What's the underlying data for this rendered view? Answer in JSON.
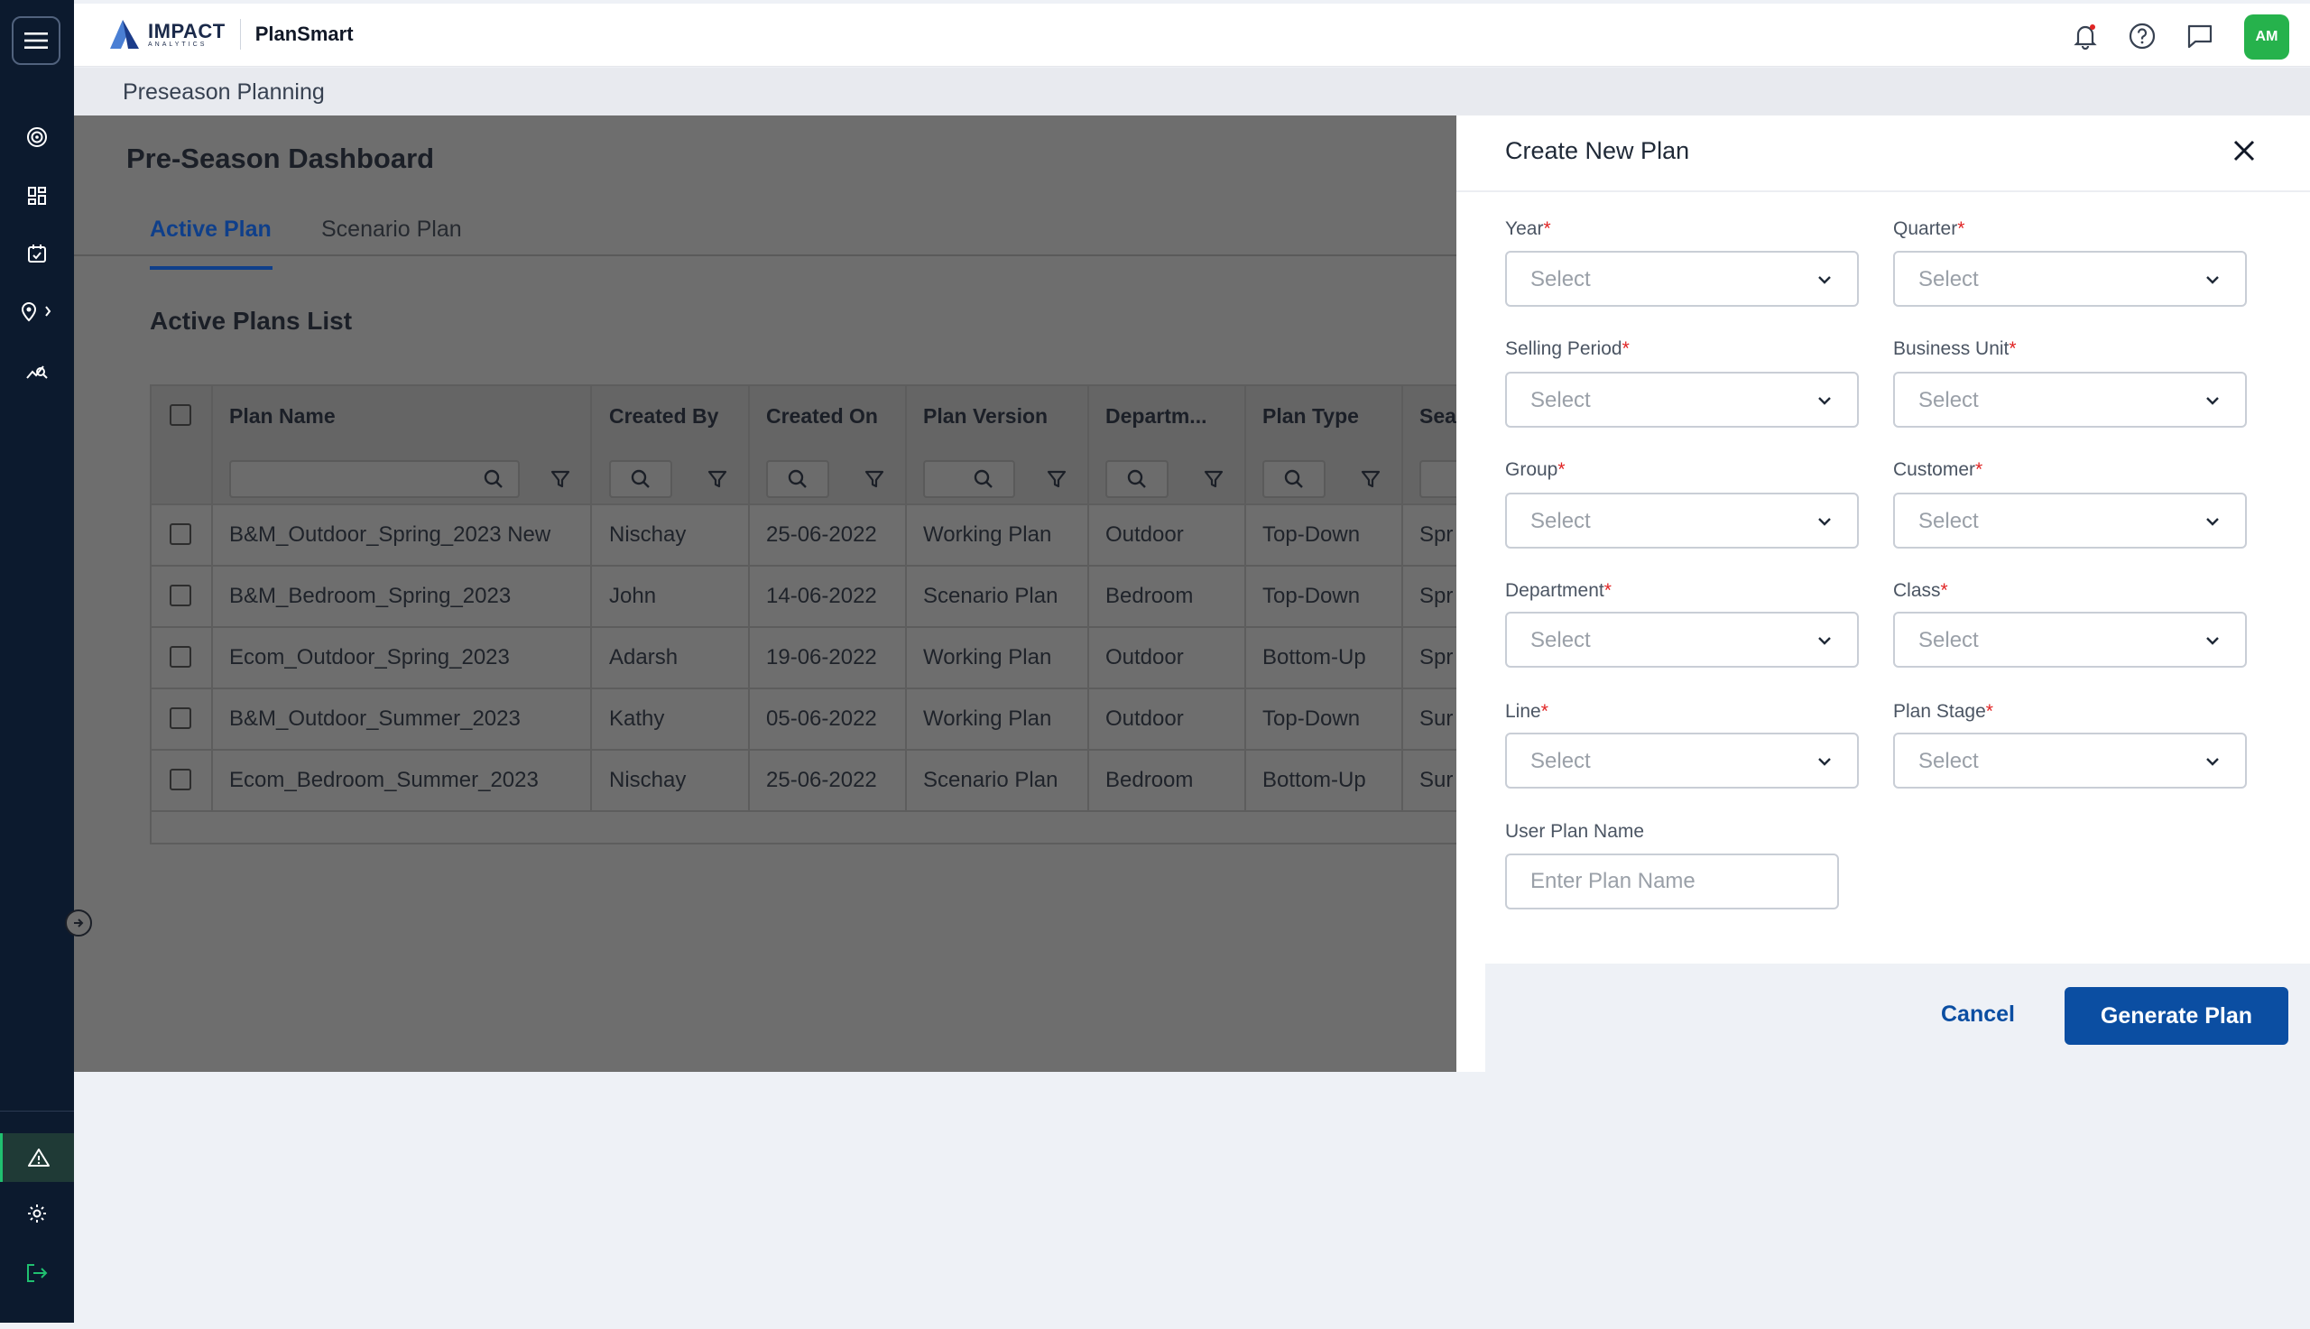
{
  "header": {
    "logo_main": "IMPACT",
    "logo_sub": "ANALYTICS",
    "app_name": "PlanSmart",
    "avatar_initials": "AM"
  },
  "breadcrumb": "Preseason Planning",
  "page": {
    "title": "Pre-Season Dashboard",
    "tabs": [
      {
        "label": "Active Plan",
        "active": true
      },
      {
        "label": "Scenario Plan",
        "active": false
      }
    ],
    "section_title": "Active Plans List"
  },
  "table": {
    "columns": [
      "Plan Name",
      "Created By",
      "Created On",
      "Plan Version",
      "Departm...",
      "Plan Type",
      "Sea"
    ],
    "rows": [
      [
        "B&M_Outdoor_Spring_2023 New",
        "Nischay",
        "25-06-2022",
        "Working Plan",
        "Outdoor",
        "Top-Down",
        "Spr"
      ],
      [
        "B&M_Bedroom_Spring_2023",
        "John",
        "14-06-2022",
        "Scenario Plan",
        "Bedroom",
        "Top-Down",
        "Spr"
      ],
      [
        "Ecom_Outdoor_Spring_2023",
        "Adarsh",
        "19-06-2022",
        "Working Plan",
        "Outdoor",
        "Bottom-Up",
        "Spr"
      ],
      [
        "B&M_Outdoor_Summer_2023",
        "Kathy",
        "05-06-2022",
        "Working Plan",
        "Outdoor",
        "Top-Down",
        "Sur"
      ],
      [
        "Ecom_Bedroom_Summer_2023",
        "Nischay",
        "25-06-2022",
        "Scenario Plan",
        "Bedroom",
        "Bottom-Up",
        "Sur"
      ]
    ]
  },
  "drawer": {
    "title": "Create New Plan",
    "fields": [
      {
        "label": "Year",
        "required": "*",
        "value": "Select"
      },
      {
        "label": "Quarter",
        "required": "*",
        "value": "Select"
      },
      {
        "label": "Selling Period",
        "required": "*",
        "value": "Select"
      },
      {
        "label": "Business Unit",
        "required": "*",
        "value": "Select"
      },
      {
        "label": "Group",
        "required": "*",
        "value": "Select"
      },
      {
        "label": "Customer",
        "required": "*",
        "value": "Select"
      },
      {
        "label": "Department",
        "required": "*",
        "value": "Select"
      },
      {
        "label": "Class",
        "required": "*",
        "value": "Select"
      },
      {
        "label": "Line",
        "required": "*",
        "value": "Select"
      },
      {
        "label": "Plan Stage",
        "required": "*",
        "value": "Select"
      }
    ],
    "plan_name_label": "User Plan Name",
    "plan_name_placeholder": "Enter Plan Name",
    "cancel_label": "Cancel",
    "generate_label": "Generate Plan"
  },
  "colors": {
    "sidebar_bg": "#0c1a2e",
    "primary": "#0b4ea2",
    "avatar": "#26b24c",
    "required": "#e02424"
  }
}
